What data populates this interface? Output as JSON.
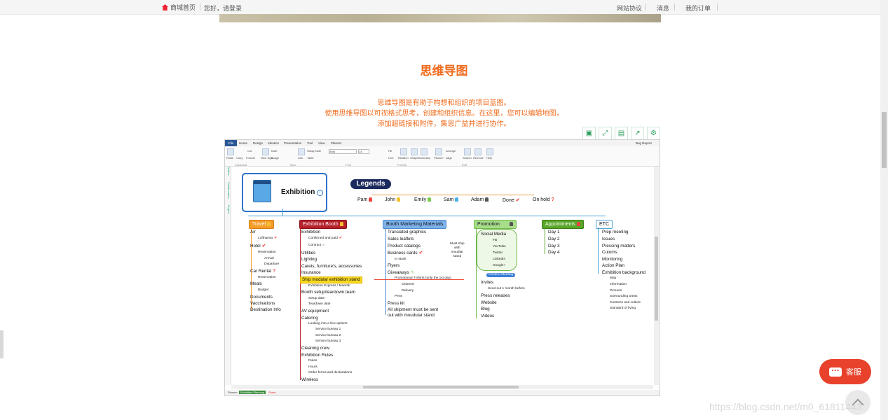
{
  "topbar": {
    "home": "商城首页",
    "login": "您好，请登录",
    "protocol": "网站协议",
    "messages": "消息",
    "orders": "我的订单"
  },
  "section": {
    "title": "思维导图",
    "desc_lines": [
      "思维导图是有助于构想和组织的项目蓝图。",
      "使用思维导图以可视格式思考，创建和组织信息。在这里，您可以编辑地图，",
      "添加超链接和附件，集思广益并进行协作。"
    ]
  },
  "toolbar_icons": [
    "open-icon",
    "fullscreen-icon",
    "save-icon",
    "share-icon",
    "settings-icon"
  ],
  "app": {
    "tabs": [
      "File",
      "Home",
      "Design",
      "Ideation",
      "Presentation",
      "Tool",
      "View",
      "Planner"
    ],
    "ribbon": {
      "paste": "Paste",
      "copy": "Copy",
      "cut": "Cut",
      "format": "Format",
      "note": "Note",
      "image": "Image",
      "new_topic": "New Topic",
      "link": "Link",
      "sticky_note": "Sticky Note",
      "table": "Table",
      "font": "Arial",
      "font_size": "14",
      "fill": "Fill",
      "line": "Line",
      "relation": "Relation",
      "shape": "Shape",
      "boundary": "Boundary",
      "planner": "Planner",
      "arrange": "Arrange",
      "align": "Align",
      "search": "Search",
      "remove": "Remove",
      "help": "Help",
      "bug_report": "Bug Report",
      "groups": [
        "Clipboard",
        "Topic",
        "Font",
        "Format",
        "Edit"
      ]
    },
    "side_tabs": [
      "Outline",
      "Collaboration",
      "Project"
    ],
    "sheets": [
      "Planner",
      "Exhibition Planning",
      "Sheet"
    ]
  },
  "mindmap": {
    "root": "Exhibition",
    "legends_title": "Legends",
    "legends": [
      {
        "label": "Pam",
        "color": "#e94343"
      },
      {
        "label": "John",
        "color": "#f2c12e"
      },
      {
        "label": "Emily",
        "color": "#7ec850"
      },
      {
        "label": "Sam",
        "color": "#4ab0e8"
      },
      {
        "label": "Adam",
        "color": "#555555"
      },
      {
        "label": "Done",
        "mark": "check"
      },
      {
        "label": "On hold",
        "mark": "q"
      }
    ],
    "categories": {
      "travel": "Travel",
      "booth": "Exhibition Booth",
      "marketing": "Booth Marketing Materials",
      "promotion": "Promotion",
      "appointments": "Appointments",
      "etc": "ETC"
    },
    "travel": {
      "items": [
        "Air",
        "Hotel",
        "Car Rental",
        "Meals",
        "Documents",
        "Vaccinations",
        "Destination Info"
      ],
      "air_sub": [
        "Lufthansa"
      ],
      "hotel_sub": [
        "Reservation",
        "Arrival",
        "Departure"
      ],
      "car_sub": [
        "Reservation"
      ],
      "meals_sub": [
        "Budget"
      ]
    },
    "booth": {
      "items": [
        "Exhibition",
        "Utilities",
        "Lighting",
        "Carets, furniture's, accessories",
        "Insurance",
        "Ship modular exhibition stand",
        "Booth setup/teardown team",
        "AV equipment",
        "Catering",
        "Cleaning crew",
        "Exhibition Rules",
        "Wireless"
      ],
      "exhibition_sub": [
        "Confirmed and paid",
        "Contract"
      ],
      "ship_sub": [
        "Exhibition Express / Maersk"
      ],
      "setup_sub": [
        "Setup date",
        "Teardown date"
      ],
      "catering_sub": [
        "Looking into a few options",
        "Service bureau 1",
        "Service bureau 2",
        "Service bureau 3"
      ],
      "rules_sub": [
        "Rules",
        "Hours",
        "Order forms and declarations"
      ]
    },
    "marketing": {
      "items": [
        "Translated graphics",
        "Sales leaflets",
        "Product catalogs",
        "Business cards",
        "Flyers",
        "Giveaways",
        "Press kit",
        "All shipment must be sent",
        "out with moudular stand"
      ],
      "cards_sub": [
        "In stock"
      ],
      "give_sub": [
        "Promotional T-shirts (only the 1st day)",
        "Ordered",
        "Delivery",
        "Pens"
      ],
      "note": [
        "Must ship",
        "with",
        "moudlar",
        "stand"
      ]
    },
    "promotion": {
      "social": "Social Media",
      "social_sub": [
        "FB",
        "YouTube",
        "Twitter",
        "LinkedIn",
        "Google+"
      ],
      "content": "Content Meeting",
      "items": [
        "Invites",
        "Press releases",
        "Website",
        "Blog",
        "Videos"
      ],
      "invites_sub": [
        "Send out 1 month before"
      ]
    },
    "appointments": {
      "items": [
        "Day 1",
        "Day 2",
        "Day 3",
        "Day 4"
      ]
    },
    "etc": {
      "items": [
        "Prep meeting",
        "Issues",
        "Pressing matters",
        "Cutoms",
        "Monitoring",
        "Action Plan",
        "Exhibition background"
      ],
      "bg_sub": [
        "Map",
        "Information",
        "Pictures",
        "Surrounding areas",
        "Customs and culture",
        "Standard of living"
      ]
    }
  },
  "chat_label": "客服",
  "watermark": "https://blog.csdn.net/m0_61811443"
}
